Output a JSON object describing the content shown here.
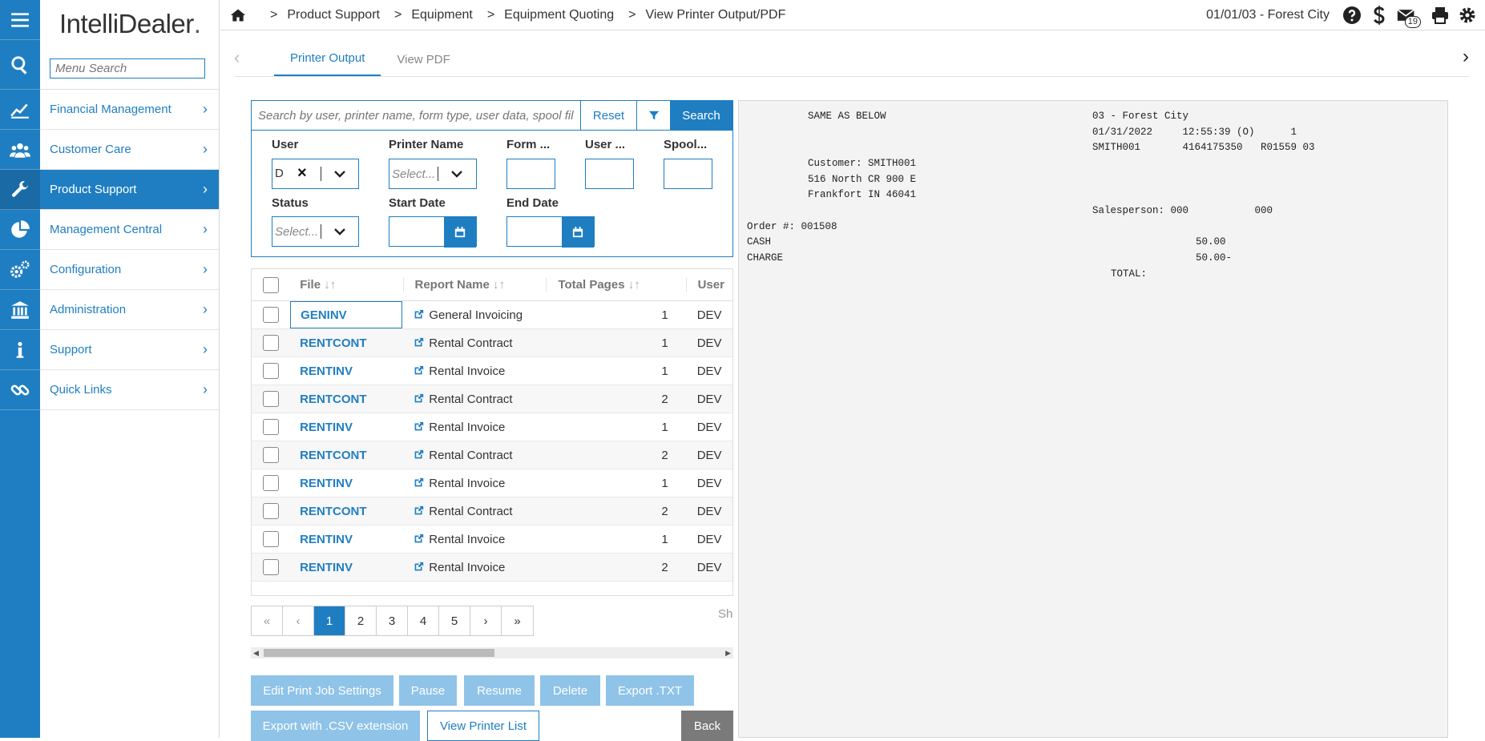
{
  "app": {
    "brand_main": "IntelliDealer",
    "brand_suffix": "."
  },
  "menu_search": {
    "placeholder": "Menu Search"
  },
  "sidebar": {
    "items": [
      {
        "label": "Financial Management",
        "icon": "chart-line-icon"
      },
      {
        "label": "Customer Care",
        "icon": "users-icon"
      },
      {
        "label": "Product Support",
        "icon": "wrench-icon",
        "active": true
      },
      {
        "label": "Management Central",
        "icon": "pie-chart-icon"
      },
      {
        "label": "Configuration",
        "icon": "gears-icon"
      },
      {
        "label": "Administration",
        "icon": "bank-icon"
      },
      {
        "label": "Support",
        "icon": "info-icon"
      },
      {
        "label": "Quick Links",
        "icon": "link-icon"
      }
    ]
  },
  "breadcrumb": [
    "Product Support",
    "Equipment",
    "Equipment Quoting",
    "View Printer Output/PDF"
  ],
  "header": {
    "date_location": "01/01/03 - Forest City",
    "mail_count": "19"
  },
  "tabs": [
    {
      "label": "Printer Output",
      "active": true
    },
    {
      "label": "View PDF",
      "active": false
    }
  ],
  "search": {
    "placeholder": "Search by user, printer name, form type, user data, spool file",
    "reset_label": "Reset",
    "search_label": "Search"
  },
  "filters": {
    "user_label": "User",
    "user_value": "D",
    "printer_label": "Printer Name",
    "printer_placeholder": "Select...",
    "form_label": "Form ...",
    "userdata_label": "User ...",
    "spool_label": "Spool...",
    "status_label": "Status",
    "status_placeholder": "Select...",
    "start_label": "Start Date",
    "end_label": "End Date"
  },
  "grid": {
    "columns": {
      "file": "File",
      "report": "Report Name",
      "pages": "Total Pages",
      "user": "User"
    },
    "rows": [
      {
        "file": "GENINV",
        "report": "General Invoicing",
        "pages": "1",
        "user": "DEV"
      },
      {
        "file": "RENTCONT",
        "report": "Rental Contract",
        "pages": "1",
        "user": "DEV"
      },
      {
        "file": "RENTINV",
        "report": "Rental Invoice",
        "pages": "1",
        "user": "DEV"
      },
      {
        "file": "RENTCONT",
        "report": "Rental Contract",
        "pages": "2",
        "user": "DEV"
      },
      {
        "file": "RENTINV",
        "report": "Rental Invoice",
        "pages": "1",
        "user": "DEV"
      },
      {
        "file": "RENTCONT",
        "report": "Rental Contract",
        "pages": "2",
        "user": "DEV"
      },
      {
        "file": "RENTINV",
        "report": "Rental Invoice",
        "pages": "1",
        "user": "DEV"
      },
      {
        "file": "RENTCONT",
        "report": "Rental Contract",
        "pages": "2",
        "user": "DEV"
      },
      {
        "file": "RENTINV",
        "report": "Rental Invoice",
        "pages": "1",
        "user": "DEV"
      },
      {
        "file": "RENTINV",
        "report": "Rental Invoice",
        "pages": "2",
        "user": "DEV"
      }
    ]
  },
  "pager": {
    "first": "«",
    "prev": "‹",
    "pages": [
      "1",
      "2",
      "3",
      "4",
      "5"
    ],
    "current": "1",
    "next": "›",
    "last": "»",
    "summary_partial": "Sh"
  },
  "actions": {
    "edit": "Edit Print Job Settings",
    "pause": "Pause",
    "resume": "Resume",
    "delete": "Delete",
    "export_txt": "Export .TXT",
    "export_csv": "Export with .CSV extension",
    "view_printer_list": "View Printer List",
    "back": "Back"
  },
  "preview": {
    "lines": [
      "SAME AS BELOW",
      "03 - Forest City",
      "01/31/2022     12:55:39 (O)      1",
      "SMITH001       4164175350   R01559 03",
      "Customer: SMITH001",
      "516 North CR 900 E",
      "Frankfort IN 46041",
      "Salesperson: 000           000",
      "Order #: 001508",
      "CASH",
      "50.00",
      "CHARGE",
      "50.00-",
      "TOTAL:"
    ]
  }
}
